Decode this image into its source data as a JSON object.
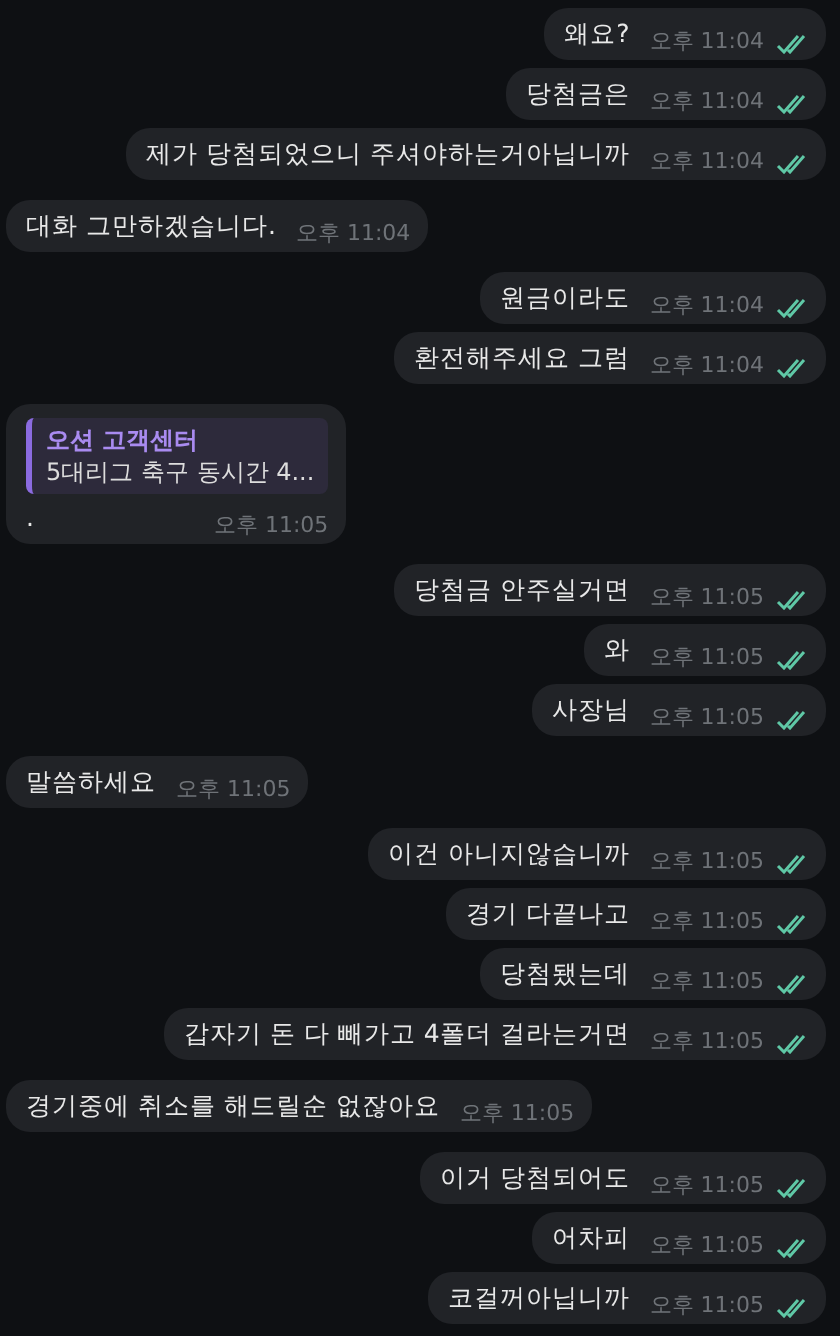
{
  "messages": [
    {
      "outgoing": true,
      "text": "왜요?",
      "time": "오후 11:04",
      "read": true
    },
    {
      "outgoing": true,
      "text": "당첨금은",
      "time": "오후 11:04",
      "read": true
    },
    {
      "outgoing": true,
      "text": "제가 당첨되었으니 주셔야하는거아닙니까",
      "time": "오후 11:04",
      "read": true
    },
    {
      "outgoing": false,
      "text": "대화 그만하겠습니다.",
      "time": "오후 11:04"
    },
    {
      "outgoing": true,
      "text": "원금이라도",
      "time": "오후 11:04",
      "read": true
    },
    {
      "outgoing": true,
      "text": "환전해주세요 그럼",
      "time": "오후 11:04",
      "read": true
    },
    {
      "outgoing": false,
      "text": ".",
      "time": "오후 11:05",
      "quote": {
        "sender": "오션 고객센터",
        "text": "5대리그 축구 동시간 4..."
      }
    },
    {
      "outgoing": true,
      "text": "당첨금 안주실거면",
      "time": "오후 11:05",
      "read": true
    },
    {
      "outgoing": true,
      "text": "와",
      "time": "오후 11:05",
      "read": true
    },
    {
      "outgoing": true,
      "text": "사장님",
      "time": "오후 11:05",
      "read": true
    },
    {
      "outgoing": false,
      "text": "말씀하세요",
      "time": "오후 11:05"
    },
    {
      "outgoing": true,
      "text": "이건 아니지않습니까",
      "time": "오후 11:05",
      "read": true
    },
    {
      "outgoing": true,
      "text": "경기 다끝나고",
      "time": "오후 11:05",
      "read": true
    },
    {
      "outgoing": true,
      "text": "당첨됐는데",
      "time": "오후 11:05",
      "read": true
    },
    {
      "outgoing": true,
      "text": "갑자기 돈 다 빼가고 4폴더 걸라는거면",
      "time": "오후 11:05",
      "read": true
    },
    {
      "outgoing": false,
      "text": "경기중에 취소를 해드릴순 없잖아요",
      "time": "오후 11:05"
    },
    {
      "outgoing": true,
      "text": "이거 당첨되어도",
      "time": "오후 11:05",
      "read": true
    },
    {
      "outgoing": true,
      "text": "어차피",
      "time": "오후 11:05",
      "read": true
    },
    {
      "outgoing": true,
      "text": "코걸꺼아닙니까",
      "time": "오후 11:05",
      "read": true
    }
  ]
}
